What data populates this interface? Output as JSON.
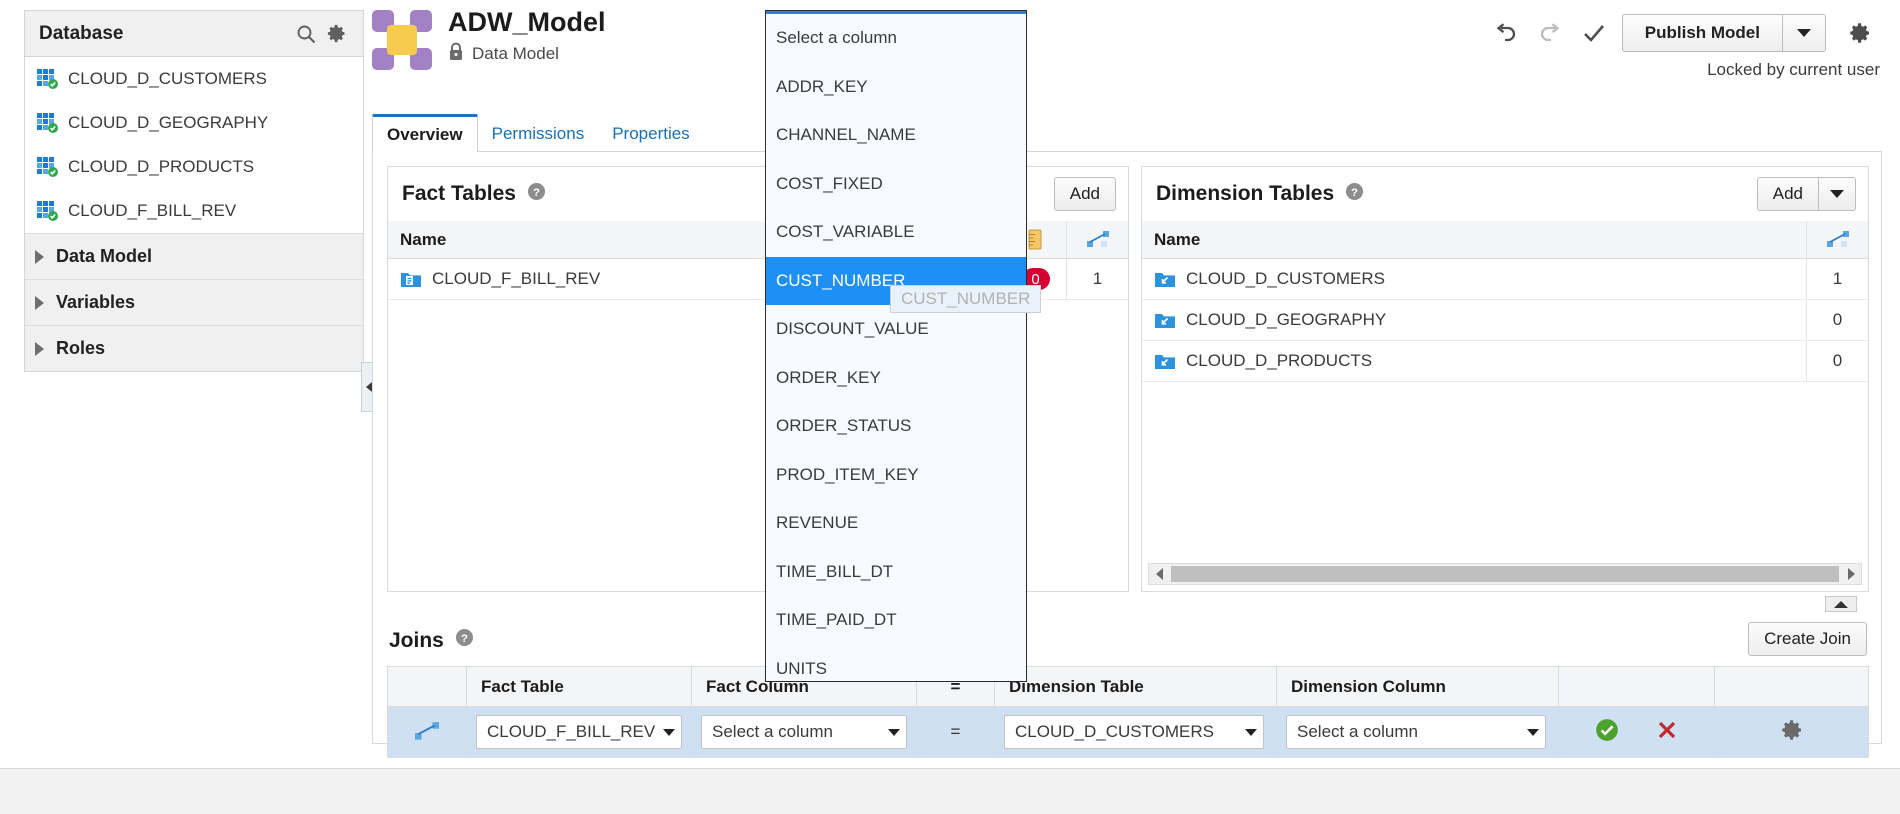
{
  "sidebar": {
    "title": "Database",
    "search_icon": "search-icon",
    "gear_icon": "gear-icon",
    "tables": [
      "CLOUD_D_CUSTOMERS",
      "CLOUD_D_GEOGRAPHY",
      "CLOUD_D_PRODUCTS",
      "CLOUD_F_BILL_REV"
    ],
    "sections": [
      "Data Model",
      "Variables",
      "Roles"
    ]
  },
  "header": {
    "title": "ADW_Model",
    "subtitle": "Data Model",
    "lock_icon": "lock-icon",
    "undo_icon": "undo-icon",
    "redo_icon": "redo-icon",
    "check_icon": "checkmark-icon",
    "publish_label": "Publish Model",
    "publish_arrow_icon": "chevron-down-icon",
    "settings_icon": "gear-icon",
    "locked_note": "Locked by current user"
  },
  "tabs": [
    {
      "label": "Overview",
      "active": true
    },
    {
      "label": "Permissions",
      "active": false
    },
    {
      "label": "Properties",
      "active": false
    }
  ],
  "fact_tables": {
    "title": "Fact Tables",
    "help_icon": "help-icon",
    "add_label": "Add",
    "columns": [
      "Name",
      "measures-column-icon",
      "joins-column-icon"
    ],
    "rows": [
      {
        "name": "CLOUD_F_BILL_REV",
        "measures": "0",
        "joins": "1"
      }
    ]
  },
  "dimension_tables": {
    "title": "Dimension Tables",
    "help_icon": "help-icon",
    "add_label": "Add",
    "add_arrow_icon": "chevron-down-icon",
    "columns": [
      "Name",
      "joins-column-icon"
    ],
    "rows": [
      {
        "name": "CLOUD_D_CUSTOMERS",
        "joins": "1"
      },
      {
        "name": "CLOUD_D_GEOGRAPHY",
        "joins": "0"
      },
      {
        "name": "CLOUD_D_PRODUCTS",
        "joins": "0"
      }
    ]
  },
  "joins": {
    "title": "Joins",
    "help_icon": "help-icon",
    "create_label": "Create Join",
    "columns": [
      "",
      "Fact Table",
      "Fact Column",
      "=",
      "Dimension Table",
      "Dimension Column",
      "",
      ""
    ],
    "row": {
      "row_icon": "join-icon",
      "fact_table": "CLOUD_F_BILL_REV",
      "fact_column": "Select a column",
      "operator": "=",
      "dimension_table": "CLOUD_D_CUSTOMERS",
      "dimension_column": "Select a column",
      "accept_icon": "accept-check-icon",
      "cancel_icon": "cancel-x-icon",
      "settings_icon": "gear-icon"
    }
  },
  "dropdown": {
    "name": "fact-column-dropdown",
    "selected": "CUST_NUMBER",
    "tooltip": "CUST_NUMBER",
    "items": [
      "Select a column",
      "ADDR_KEY",
      "CHANNEL_NAME",
      "COST_FIXED",
      "COST_VARIABLE",
      "CUST_NUMBER",
      "DISCOUNT_VALUE",
      "ORDER_KEY",
      "ORDER_STATUS",
      "PROD_ITEM_KEY",
      "REVENUE",
      "TIME_BILL_DT",
      "TIME_PAID_DT",
      "UNITS"
    ]
  },
  "colors": {
    "accent": "#1e90f5",
    "badge_red": "#d50032",
    "tab_blue": "#1a73c4",
    "logo_purple": "#a281c4",
    "logo_yellow": "#f6cb4e"
  }
}
